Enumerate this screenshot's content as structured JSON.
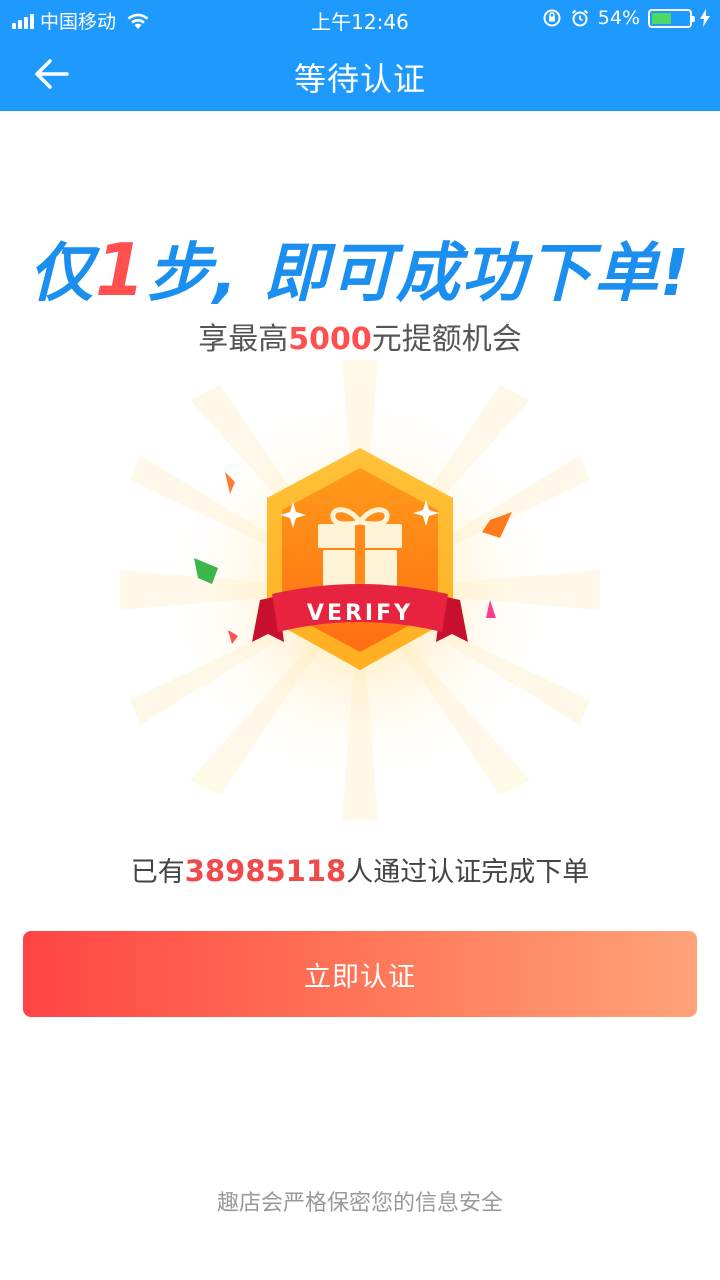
{
  "status_bar": {
    "carrier": "中国移动",
    "time": "上午12:46",
    "battery_percent": "54%",
    "battery_level": 0.54,
    "icons": [
      "signal-icon",
      "wifi-icon",
      "orientation-lock-icon",
      "alarm-icon",
      "battery-icon",
      "charging-icon"
    ]
  },
  "nav": {
    "title": "等待认证",
    "back_icon": "back-arrow-icon"
  },
  "hero": {
    "headline_prefix": "仅",
    "headline_number": "1",
    "headline_suffix": "步, 即可成功下单!",
    "sub_prefix": "享最高",
    "sub_amount": "5000",
    "sub_suffix": "元提额机会",
    "badge_ribbon_text": "VERIFY",
    "badge_icon": "gift-icon"
  },
  "stats": {
    "prefix": "已有",
    "count": "38985118",
    "suffix": "人通过认证完成下单"
  },
  "verify_button": {
    "label": "立即认证"
  },
  "footer": {
    "note": "趣店会严格保密您的信息安全"
  },
  "colors": {
    "header_blue": "#1e9aff",
    "accent_red": "#ff4f4f",
    "headline_blue": "#1a8fef",
    "button_gradient_start": "#ff4444",
    "button_gradient_end": "#ffa37a",
    "badge_orange": "#ff8a1a"
  }
}
